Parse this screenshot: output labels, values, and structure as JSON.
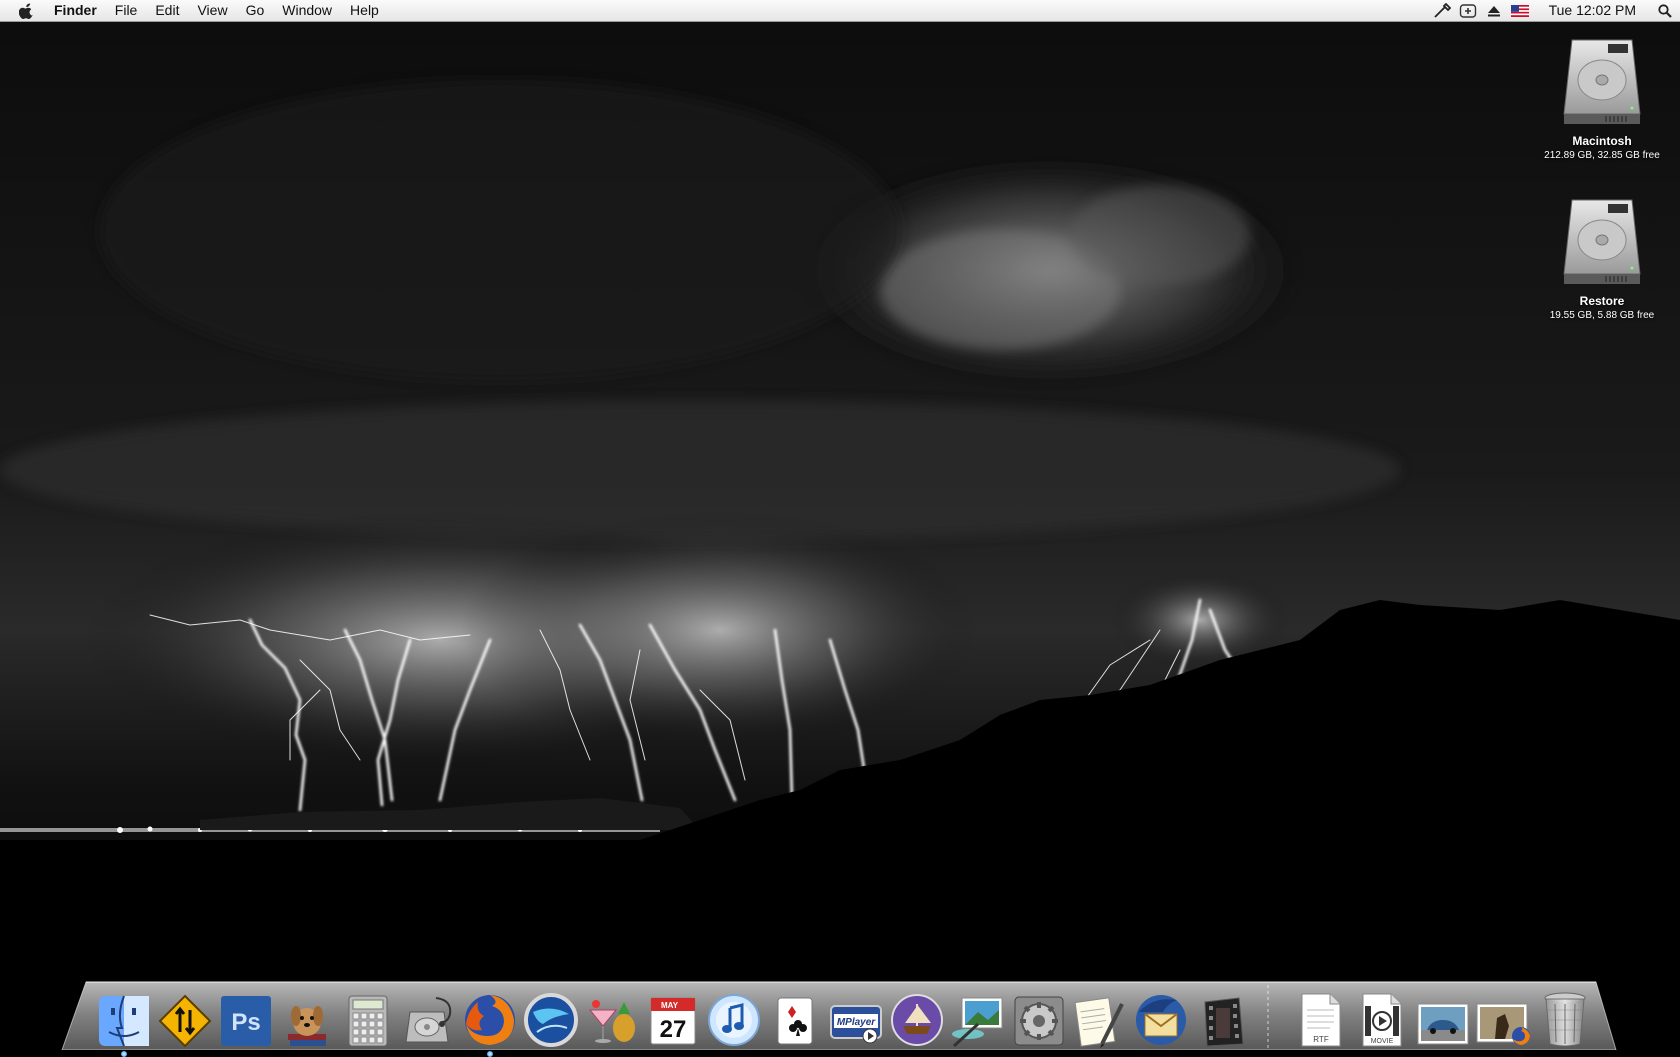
{
  "menubar": {
    "apple_icon": "apple-icon",
    "app_name": "Finder",
    "items": [
      "File",
      "Edit",
      "View",
      "Go",
      "Window",
      "Help"
    ],
    "status_icons": [
      "script-icon",
      "network-plus-icon",
      "eject-icon",
      "us-flag-icon"
    ],
    "clock": "Tue 12:02 PM",
    "spotlight_icon": "magnifier-icon"
  },
  "desktop": {
    "wallpaper": "night lightning storm over desert",
    "drives": [
      {
        "name": "Macintosh",
        "info": "212.89 GB, 32.85 GB free",
        "icon": "hard-drive-icon"
      },
      {
        "name": "Restore",
        "info": "19.55 GB, 5.88 GB free",
        "icon": "hard-drive-icon"
      }
    ]
  },
  "dock": {
    "apps": [
      {
        "name": "Finder",
        "icon": "finder-icon",
        "running": true
      },
      {
        "name": "Transmit",
        "icon": "road-sign-icon",
        "running": false
      },
      {
        "name": "Photoshop",
        "icon": "photoshop-icon",
        "label": "Ps",
        "running": false
      },
      {
        "name": "Dictionary",
        "icon": "dog-with-books-icon",
        "running": false
      },
      {
        "name": "Calculator",
        "icon": "calculator-icon",
        "running": false
      },
      {
        "name": "Disk Utility",
        "icon": "disk-utility-icon",
        "running": false
      },
      {
        "name": "Firefox",
        "icon": "firefox-icon",
        "running": true
      },
      {
        "name": "Google Earth",
        "icon": "globe-icon",
        "running": false
      },
      {
        "name": "Adium",
        "icon": "cocktail-icon",
        "running": false
      },
      {
        "name": "iCal",
        "icon": "calendar-icon",
        "month": "MAY",
        "day": "27",
        "running": false
      },
      {
        "name": "iTunes",
        "icon": "itunes-icon",
        "running": false
      },
      {
        "name": "Solitaire",
        "icon": "playing-cards-icon",
        "running": false
      },
      {
        "name": "MPlayer",
        "icon": "mplayer-icon",
        "label": "MPlayer",
        "running": false
      },
      {
        "name": "Front Row",
        "icon": "ship-icon",
        "running": false
      },
      {
        "name": "Preview",
        "icon": "photo-wand-icon",
        "running": false
      },
      {
        "name": "System Preferences",
        "icon": "gear-icon",
        "running": false
      },
      {
        "name": "TextEdit",
        "icon": "pen-paper-icon",
        "running": false
      },
      {
        "name": "Thunderbird",
        "icon": "thunderbird-icon",
        "running": false
      },
      {
        "name": "Film Strip",
        "icon": "film-icon",
        "running": false
      }
    ],
    "docs": [
      {
        "name": "RTF Document",
        "icon": "rtf-document-icon",
        "label": "RTF"
      },
      {
        "name": "Movie",
        "icon": "movie-document-icon",
        "label": "MOVIE"
      },
      {
        "name": "Car Photo",
        "icon": "photo-car-icon"
      },
      {
        "name": "Downloads",
        "icon": "downloads-firefox-icon"
      },
      {
        "name": "Trash",
        "icon": "trash-icon"
      }
    ],
    "accent_color": "#5fb6ff"
  }
}
